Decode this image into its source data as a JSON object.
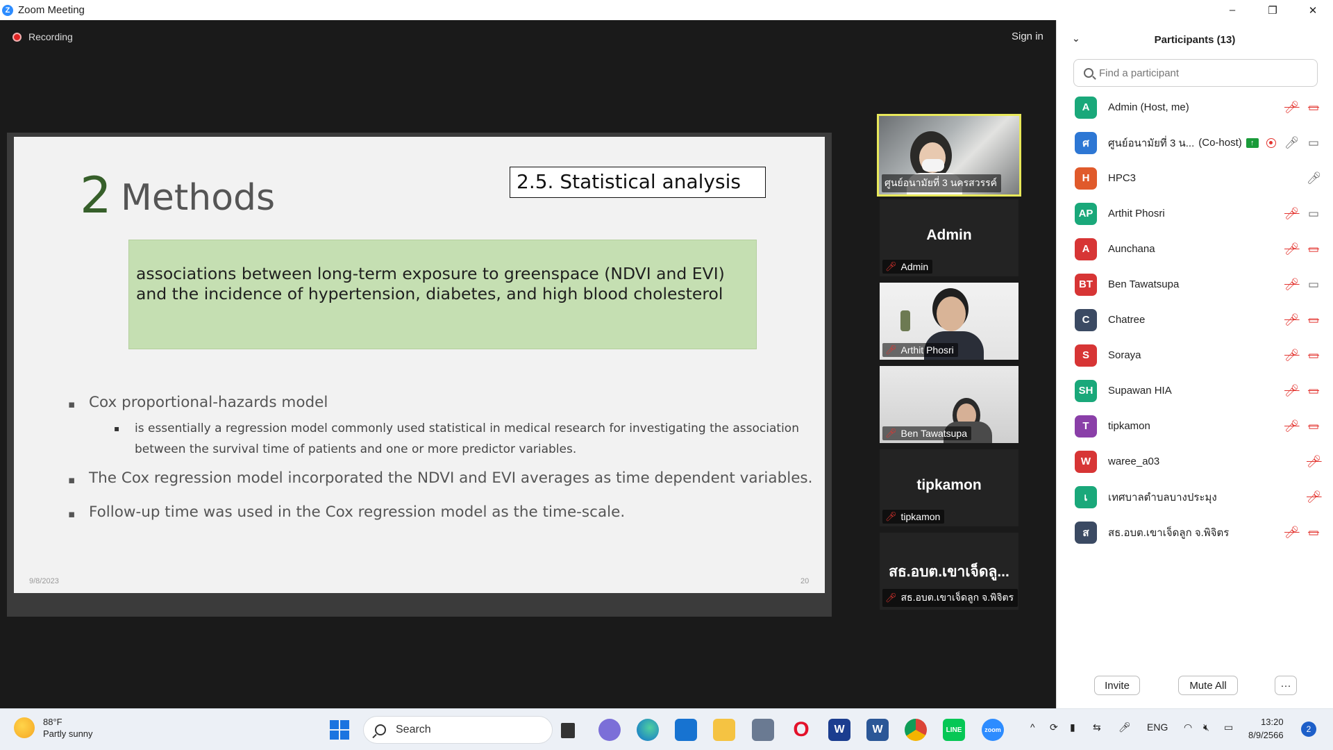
{
  "window": {
    "title": "Zoom Meeting",
    "logo_letter": "Z",
    "minimize": "–",
    "restore": "❐",
    "close": "✕"
  },
  "meeting": {
    "recording_label": "Recording",
    "sign_in": "Sign in"
  },
  "slide": {
    "section_number": "2",
    "section_title": "Methods",
    "subsection": "2.5. Statistical analysis",
    "highlight_line1": "associations between long-term exposure to greenspace (NDVI and EVI)",
    "highlight_line2": "and the incidence of hypertension, diabetes, and high blood cholesterol",
    "bullet1": "Cox proportional-hazards model",
    "bullet1_sub": "is essentially a regression model commonly used statistical in medical research for investigating the association between the survival time of patients and one or more predictor variables.",
    "bullet2": "The Cox regression model incorporated the NDVI and EVI averages as time dependent variables.",
    "bullet3": "Follow-up time was used in the Cox regression model as the time-scale.",
    "date": "9/8/2023",
    "page": "20"
  },
  "tiles": [
    {
      "name": "ศูนย์อนามัยที่ 3 นครสวรรค์"
    },
    {
      "big": "Admin",
      "name": "Admin"
    },
    {
      "name": "Arthit Phosri"
    },
    {
      "name": "Ben Tawatsupa"
    },
    {
      "big": "tipkamon",
      "name": "tipkamon"
    },
    {
      "big": "สธ.อบต.เขาเจ็ดลู...",
      "name": "สธ.อบต.เขาเจ็ดลูก จ.พิจิตร"
    }
  ],
  "participants": {
    "title": "Participants (13)",
    "search_placeholder": "Find a participant",
    "invite": "Invite",
    "mute_all": "Mute All",
    "more": "···",
    "list": [
      {
        "initials": "A",
        "name": "Admin (Host, me)",
        "color": "#1aa87a"
      },
      {
        "initials": "ศ",
        "name": "ศูนย์อนามัยที่ 3 น...",
        "tag": "(Co-host)",
        "color": "#2d77d4"
      },
      {
        "initials": "H",
        "name": "HPC3",
        "color": "#e05a2b"
      },
      {
        "initials": "AP",
        "name": "Arthit Phosri",
        "color": "#1aa87a"
      },
      {
        "initials": "A",
        "name": "Aunchana",
        "color": "#d73535"
      },
      {
        "initials": "BT",
        "name": "Ben Tawatsupa",
        "color": "#d73535"
      },
      {
        "initials": "C",
        "name": "Chatree",
        "color": "#3b4a63"
      },
      {
        "initials": "S",
        "name": "Soraya",
        "color": "#d73535"
      },
      {
        "initials": "SH",
        "name": "Supawan HIA",
        "color": "#1aa87a"
      },
      {
        "initials": "T",
        "name": "tipkamon",
        "color": "#8a3fa8"
      },
      {
        "initials": "W",
        "name": "waree_a03",
        "color": "#d73535"
      },
      {
        "initials": "เ",
        "name": "เทศบาลตำบลบางประมุง",
        "color": "#1aa87a"
      },
      {
        "initials": "ส",
        "name": "สธ.อบต.เขาเจ็ดลูก จ.พิจิตร",
        "color": "#3b4a63"
      }
    ]
  },
  "taskbar": {
    "temperature": "88°F",
    "weather": "Partly sunny",
    "search": "Search",
    "language": "ENG",
    "time": "13:20",
    "date": "8/9/2566",
    "notifications": "2"
  }
}
